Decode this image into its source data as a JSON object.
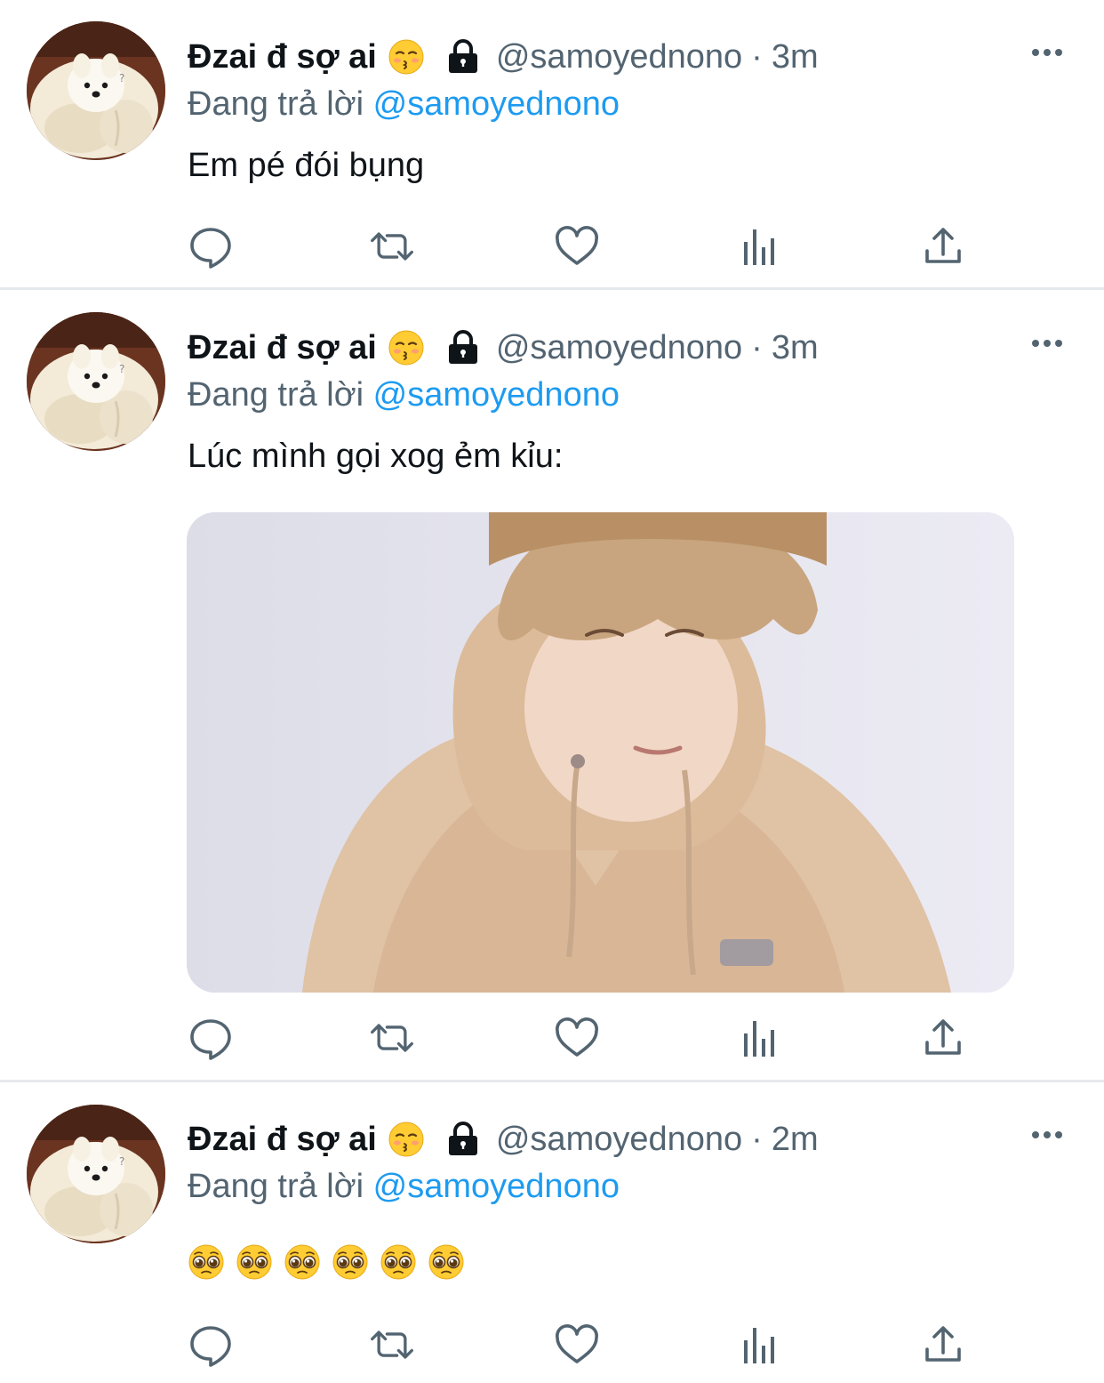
{
  "tweets": [
    {
      "display_name": "Đzai đ sợ ai",
      "handle": "@samoyednono",
      "separator": "·",
      "time": "3m",
      "reply_prefix": "Đang trả lời",
      "reply_to": "@samoyednono",
      "text": "Em pé đói bụng",
      "has_media": false
    },
    {
      "display_name": "Đzai đ sợ ai",
      "handle": "@samoyednono",
      "separator": "·",
      "time": "3m",
      "reply_prefix": "Đang trả lời",
      "reply_to": "@samoyednono",
      "text": "Lúc mình gọi xog ẻm kỉu:",
      "has_media": true
    },
    {
      "display_name": "Đzai đ sợ ai",
      "handle": "@samoyednono",
      "separator": "·",
      "time": "2m",
      "reply_prefix": "Đang trả lời",
      "reply_to": "@samoyednono",
      "text_emoji": [
        "pleading-face",
        "pleading-face",
        "pleading-face",
        "pleading-face",
        "pleading-face",
        "pleading-face"
      ],
      "has_media": false
    }
  ],
  "icons": {
    "name_emoji": "kissing-face-with-closed-eyes",
    "protected": "lock-icon",
    "more": "more-horizontal-icon",
    "actions": [
      "reply-icon",
      "retweet-icon",
      "like-icon",
      "analytics-icon",
      "share-icon"
    ]
  },
  "colors": {
    "text_primary": "#0f1419",
    "text_secondary": "#536471",
    "link": "#1d9bf0",
    "divider": "#e6e9ec"
  }
}
